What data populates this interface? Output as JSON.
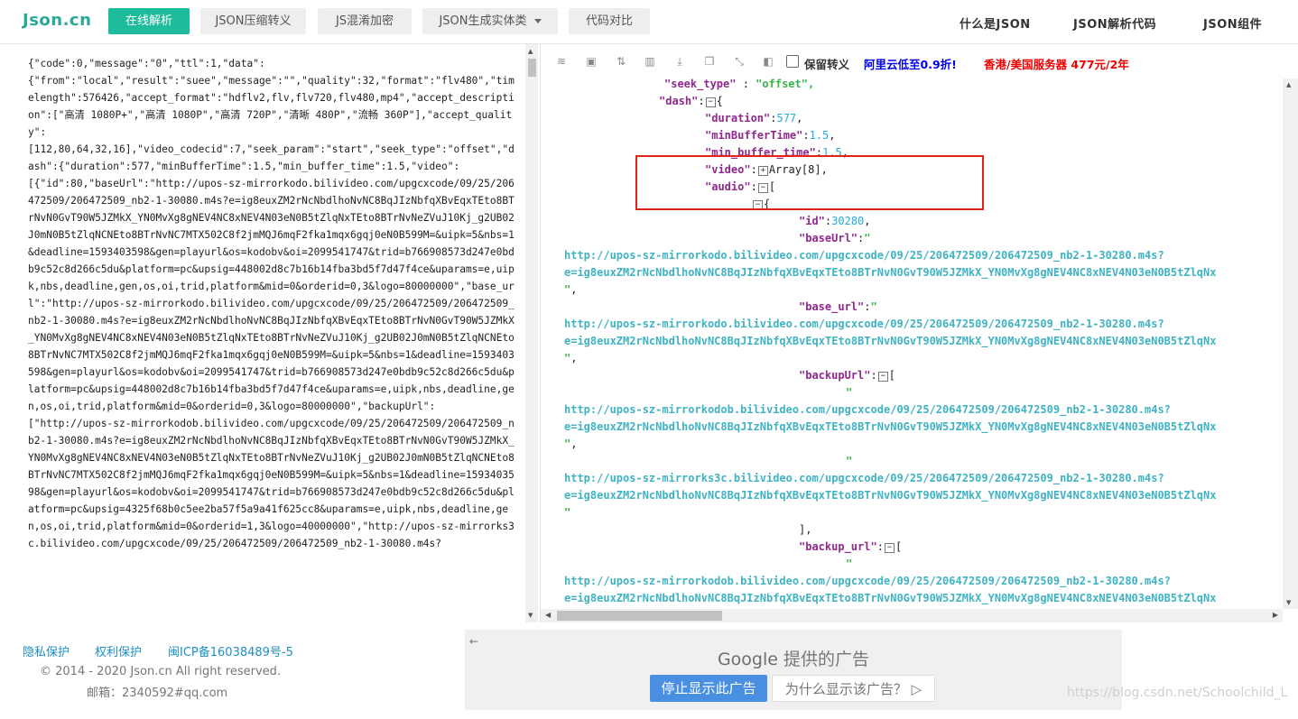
{
  "header": {
    "logo": "Json.cn",
    "nav": [
      "在线解析",
      "JSON压缩转义",
      "JS混淆加密",
      "JSON生成实体类",
      "代码对比"
    ],
    "right_nav": [
      "什么是JSON",
      "JSON解析代码",
      "JSON组件"
    ]
  },
  "left_pane": {
    "raw_json": "{\"code\":0,\"message\":\"0\",\"ttl\":1,\"data\":\n{\"from\":\"local\",\"result\":\"suee\",\"message\":\"\",\"quality\":32,\"format\":\"flv480\",\"timelength\":576426,\"accept_format\":\"hdflv2,flv,flv720,flv480,mp4\",\"accept_description\":[\"高清 1080P+\",\"高清 1080P\",\"高清 720P\",\"清晰 480P\",\"流畅 360P\"],\"accept_quality\":\n[112,80,64,32,16],\"video_codecid\":7,\"seek_param\":\"start\",\"seek_type\":\"offset\",\"dash\":{\"duration\":577,\"minBufferTime\":1.5,\"min_buffer_time\":1.5,\"video\":\n[{\"id\":80,\"baseUrl\":\"http://upos-sz-mirrorkodo.bilivideo.com/upgcxcode/09/25/206472509/206472509_nb2-1-30080.m4s?e=ig8euxZM2rNcNbdlhoNvNC8BqJIzNbfqXBvEqxTEto8BTrNvN0GvT90W5JZMkX_YN0MvXg8gNEV4NC8xNEV4N03eN0B5tZlqNxTEto8BTrNvNeZVuJ10Kj_g2UB02J0mN0B5tZlqNCNEto8BTrNvNC7MTX502C8f2jmMQJ6mqF2fka1mqx6gqj0eN0B599M=&uipk=5&nbs=1&deadline=1593403598&gen=playurl&os=kodobv&oi=2099541747&trid=b766908573d247e0bdb9c52c8d266c5du&platform=pc&upsig=448002d8c7b16b14fba3bd5f7d47f4ce&uparams=e,uipk,nbs,deadline,gen,os,oi,trid,platform&mid=0&orderid=0,3&logo=80000000\",\"base_url\":\"http://upos-sz-mirrorkodo.bilivideo.com/upgcxcode/09/25/206472509/206472509_nb2-1-30080.m4s?e=ig8euxZM2rNcNbdlhoNvNC8BqJIzNbfqXBvEqxTEto8BTrNvN0GvT90W5JZMkX_YN0MvXg8gNEV4NC8xNEV4N03eN0B5tZlqNxTEto8BTrNvNeZVuJ10Kj_g2UB02J0mN0B5tZlqNCNEto8BTrNvNC7MTX502C8f2jmMQJ6mqF2fka1mqx6gqj0eN0B599M=&uipk=5&nbs=1&deadline=1593403598&gen=playurl&os=kodobv&oi=2099541747&trid=b766908573d247e0bdb9c52c8d266c5du&platform=pc&upsig=448002d8c7b16b14fba3bd5f7d47f4ce&uparams=e,uipk,nbs,deadline,gen,os,oi,trid,platform&mid=0&orderid=0,3&logo=80000000\",\"backupUrl\":\n[\"http://upos-sz-mirrorkodob.bilivideo.com/upgcxcode/09/25/206472509/206472509_nb2-1-30080.m4s?e=ig8euxZM2rNcNbdlhoNvNC8BqJIzNbfqXBvEqxTEto8BTrNvN0GvT90W5JZMkX_YN0MvXg8gNEV4NC8xNEV4N03eN0B5tZlqNxTEto8BTrNvNeZVuJ10Kj_g2UB02J0mN0B5tZlqNCNEto8BTrNvNC7MTX502C8f2jmMQJ6mqF2fka1mqx6gqj0eN0B599M=&uipk=5&nbs=1&deadline=1593403598&gen=playurl&os=kodobv&oi=2099541747&trid=b766908573d247e0bdb9c52c8d266c5du&platform=pc&upsig=4325f68b0c5ee2ba57f5a9a41f625cc8&uparams=e,uipk,nbs,deadline,gen,os,oi,trid,platform&mid=0&orderid=1,3&logo=40000000\",\"http://upos-sz-mirrorks3c.bilivideo.com/upgcxcode/09/25/206472509/206472509_nb2-1-30080.m4s?"
  },
  "toolbar": {
    "icons": [
      "database-icon",
      "file-excel-icon",
      "sort-icon",
      "trash-icon",
      "download-icon",
      "copy-icon",
      "compress-icon",
      "expand-icon"
    ],
    "keep_escape_label": "保留转义",
    "ad_aliyun": "阿里云低至0.9折!",
    "ad_hk": "香港/美国服务器 477元/2年"
  },
  "viewer": {
    "seek_type_key": "\"seek_type\"",
    "seek_type_val": "\"offset\",",
    "dash_key": "\"dash\"",
    "duration_key": "\"duration\"",
    "duration_val": "577",
    "minbuf_key": "\"minBufferTime\"",
    "minbuf_val": "1.5",
    "min_buf_key": "\"min_buffer_time\"",
    "min_buf_val": "1.5",
    "video_key": "\"video\"",
    "video_val": "Array[8]",
    "audio_key": "\"audio\"",
    "id_key": "\"id\"",
    "id_val": "30280",
    "baseurl_key": "\"baseUrl\"",
    "base_url_key": "\"base_url\"",
    "backupurl_key": "\"backupUrl\"",
    "backup_url_key": "\"backup_url\"",
    "url_line1_kodo": "http://upos-sz-mirrorkodo.bilivideo.com/upgcxcode/09/25/206472509/206472509_nb2-1-30280.m4s?",
    "url_line1_kodob": "http://upos-sz-mirrorkodob.bilivideo.com/upgcxcode/09/25/206472509/206472509_nb2-1-30280.m4s?",
    "url_line1_ks3c": "http://upos-sz-mirrorks3c.bilivideo.com/upgcxcode/09/25/206472509/206472509_nb2-1-30280.m4s?",
    "url_line2": "e=ig8euxZM2rNcNbdlhoNvNC8BqJIzNbfqXBvEqxTEto8BTrNvN0GvT90W5JZMkX_YN0MvXg8gNEV4NC8xNEV4N03eN0B5tZlqNx"
  },
  "footer": {
    "links": [
      "隐私保护",
      "权利保护",
      "闽ICP备16038489号-5"
    ],
    "copyright": "© 2014 - 2020 Json.cn All right reserved.",
    "email": "邮箱：2340592#qq.com",
    "ad_google": "Google",
    "ad_provided": "提供的广告",
    "ad_stop": "停止显示此广告",
    "ad_why": "为什么显示该广告？",
    "watermark": "https://blog.csdn.net/Schoolchild_L"
  }
}
